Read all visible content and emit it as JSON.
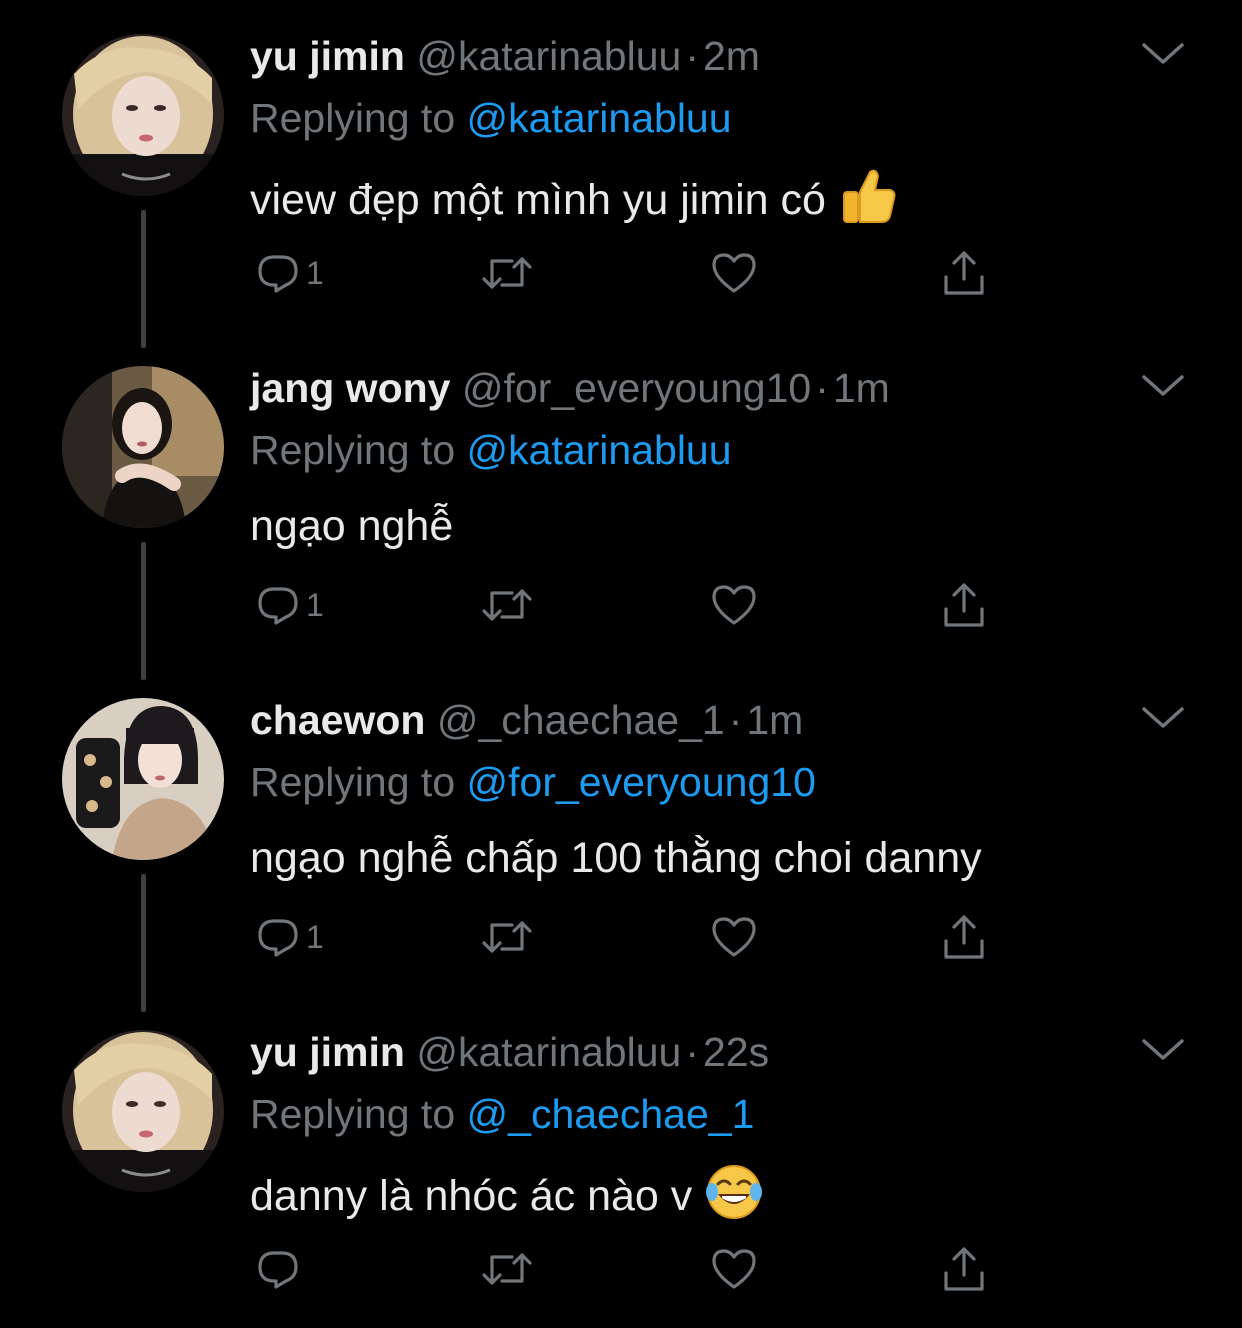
{
  "colors": {
    "background": "#000000",
    "primary_text": "#e7e9ea",
    "secondary_text": "#71767b",
    "link": "#1d9bf0",
    "thread_line": "#3e4144"
  },
  "icons": {
    "reply": "reply-icon",
    "retweet": "retweet-icon",
    "like": "heart-icon",
    "share": "share-icon",
    "more": "chevron-down-icon"
  },
  "tweets": [
    {
      "name": "yu jimin",
      "handle": "@katarinabluu",
      "separator": "·",
      "time": "2m",
      "replying_prefix": "Replying to",
      "replying_to": "@katarinabluu",
      "text": "view đẹp một mình yu jimin có",
      "emoji": "thumbs-up",
      "reply_count": "1"
    },
    {
      "name": "jang wony",
      "handle": "@for_everyoung10",
      "separator": "·",
      "time": "1m",
      "replying_prefix": "Replying to",
      "replying_to": "@katarinabluu",
      "text": "ngạo nghễ",
      "emoji": "",
      "reply_count": "1"
    },
    {
      "name": "chaewon",
      "handle": "@_chaechae_1",
      "separator": "·",
      "time": "1m",
      "replying_prefix": "Replying to",
      "replying_to": "@for_everyoung10",
      "text": "ngạo nghễ chấp 100 thằng choi danny",
      "emoji": "",
      "reply_count": "1"
    },
    {
      "name": "yu jimin",
      "handle": "@katarinabluu",
      "separator": "·",
      "time": "22s",
      "replying_prefix": "Replying to",
      "replying_to": "@_chaechae_1",
      "text": "danny là nhóc ác nào v",
      "emoji": "face-with-tears-of-joy",
      "reply_count": ""
    }
  ]
}
